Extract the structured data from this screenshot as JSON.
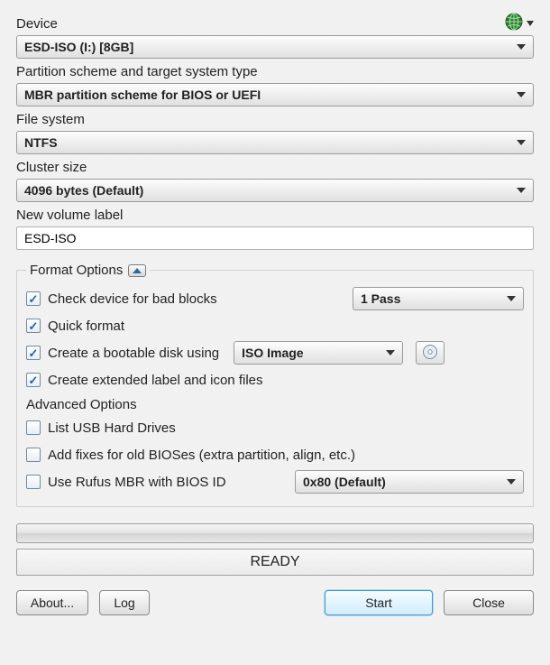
{
  "labels": {
    "device": "Device",
    "partition": "Partition scheme and target system type",
    "filesystem": "File system",
    "cluster": "Cluster size",
    "volume": "New volume label",
    "format_legend": "Format Options",
    "advanced": "Advanced Options"
  },
  "device": {
    "value": "ESD-ISO (I:) [8GB]"
  },
  "partition": {
    "value": "MBR partition scheme for BIOS or UEFI"
  },
  "filesystem": {
    "value": "NTFS"
  },
  "cluster": {
    "value": "4096 bytes (Default)"
  },
  "volume": {
    "value": "ESD-ISO"
  },
  "format": {
    "bad_blocks": {
      "checked": true,
      "label": "Check device for bad blocks",
      "passes": "1 Pass"
    },
    "quick": {
      "checked": true,
      "label": "Quick format"
    },
    "bootable": {
      "checked": true,
      "label": "Create a bootable disk using",
      "source": "ISO Image"
    },
    "extended": {
      "checked": true,
      "label": "Create extended label and icon files"
    }
  },
  "advanced": {
    "list_usb": {
      "checked": false,
      "label": "List USB Hard Drives"
    },
    "old_bios": {
      "checked": false,
      "label": "Add fixes for old BIOSes (extra partition, align, etc.)"
    },
    "rufus_mbr": {
      "checked": false,
      "label": "Use Rufus MBR with BIOS ID",
      "bios_id": "0x80 (Default)"
    }
  },
  "progress": {
    "value": 0
  },
  "status": "READY",
  "buttons": {
    "about": "About...",
    "log": "Log",
    "start": "Start",
    "close": "Close"
  }
}
